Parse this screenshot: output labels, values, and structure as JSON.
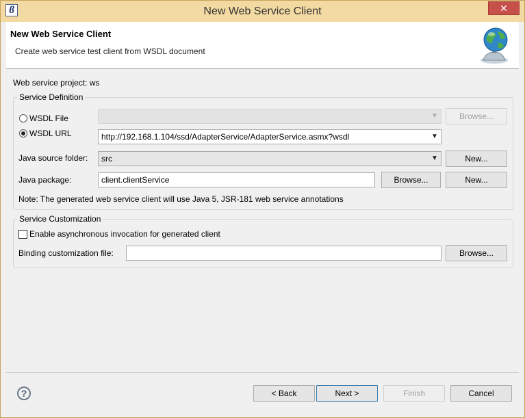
{
  "window": {
    "title": "New Web Service Client",
    "close_label": "✕",
    "app_icon_glyph": "ϐ"
  },
  "banner": {
    "title": "New Web Service Client",
    "description": "Create web service test client from WSDL document",
    "icon": "globe-icon"
  },
  "project": {
    "label": "Web service project: ws"
  },
  "service_definition": {
    "group_label": "Service Definition",
    "wsdl_file": {
      "label": "WSDL File",
      "checked": false,
      "value": "",
      "browse_label": "Browse..."
    },
    "wsdl_url": {
      "label": "WSDL URL",
      "checked": true,
      "value": "http://192.168.1.104/ssd/AdapterService/AdapterService.asmx?wsdl"
    },
    "java_source_folder": {
      "label": "Java source folder:",
      "value": "src",
      "new_label": "New..."
    },
    "java_package": {
      "label": "Java package:",
      "value": "client.clientService",
      "browse_label": "Browse...",
      "new_label": "New..."
    },
    "note": "Note: The generated web service client will use Java 5, JSR-181 web service annotations"
  },
  "service_customization": {
    "group_label": "Service Customization",
    "async": {
      "label": "Enable asynchronous invocation for generated client",
      "checked": false
    },
    "binding": {
      "label": "Binding customization file:",
      "value": "",
      "browse_label": "Browse..."
    }
  },
  "footer": {
    "help_glyph": "?",
    "back_label": "< Back",
    "next_label": "Next >",
    "finish_label": "Finish",
    "cancel_label": "Cancel"
  },
  "colors": {
    "titlebar": "#f3d9a2",
    "close_button": "#c7504a",
    "dialog_bg": "#f0f0f0",
    "default_button_border": "#3c7fb1"
  }
}
